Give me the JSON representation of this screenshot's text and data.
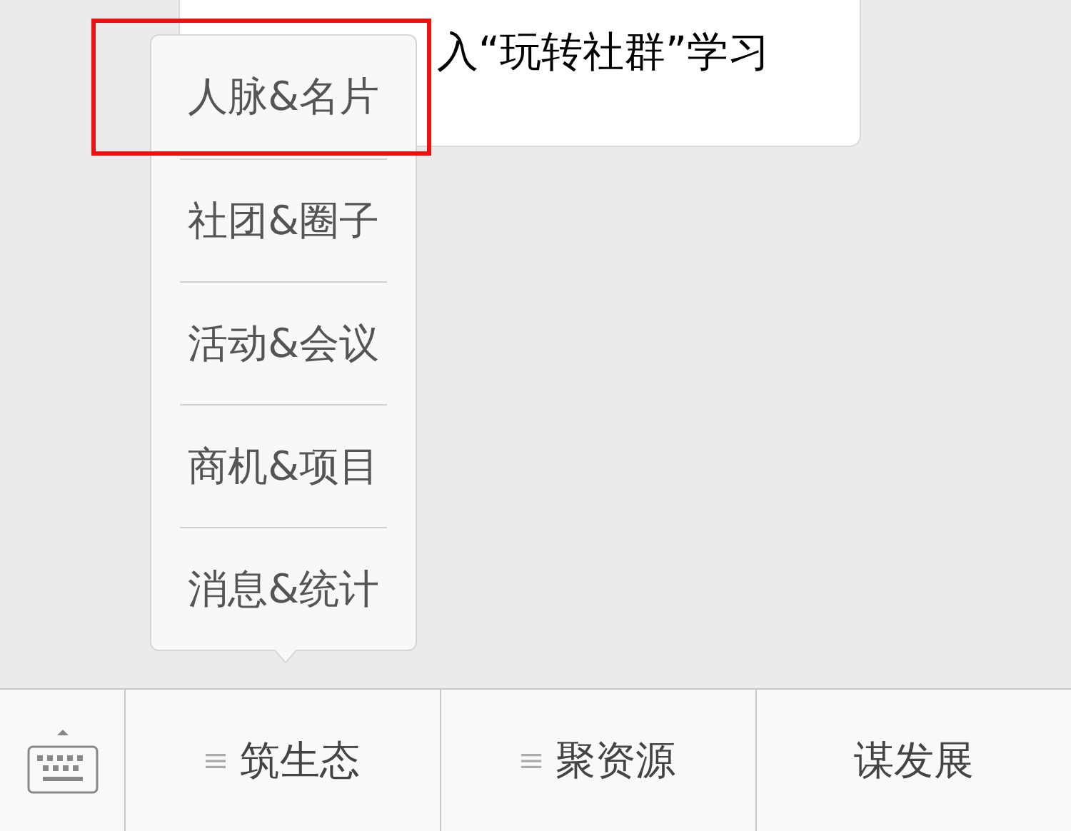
{
  "message": {
    "text": "入“玩转社群”学习"
  },
  "popup_menu": {
    "items": [
      {
        "label": "人脉&名片",
        "highlighted": true
      },
      {
        "label": "社团&圈子",
        "highlighted": false
      },
      {
        "label": "活动&会议",
        "highlighted": false
      },
      {
        "label": "商机&项目",
        "highlighted": false
      },
      {
        "label": "消息&统计",
        "highlighted": false
      }
    ]
  },
  "bottom_menu": [
    {
      "label": "筑生态",
      "has_submenu": true
    },
    {
      "label": "聚资源",
      "has_submenu": true
    },
    {
      "label": "谋发展",
      "has_submenu": false
    }
  ]
}
